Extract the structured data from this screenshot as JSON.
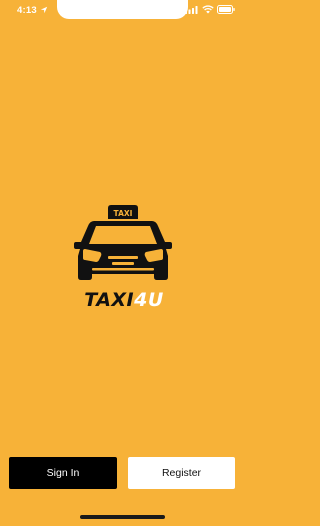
{
  "status_bar": {
    "time": "4:13",
    "icons": [
      "location-arrow-icon",
      "cellular-signal-icon",
      "wifi-icon",
      "battery-icon"
    ]
  },
  "logo": {
    "roof_sign_text": "TAXI",
    "wordmark_main": "TAXI",
    "wordmark_accent": "4U"
  },
  "actions": {
    "sign_in_label": "Sign In",
    "register_label": "Register"
  },
  "colors": {
    "background": "#f7b238",
    "sign_in_bg": "#000000",
    "register_bg": "#ffffff"
  }
}
